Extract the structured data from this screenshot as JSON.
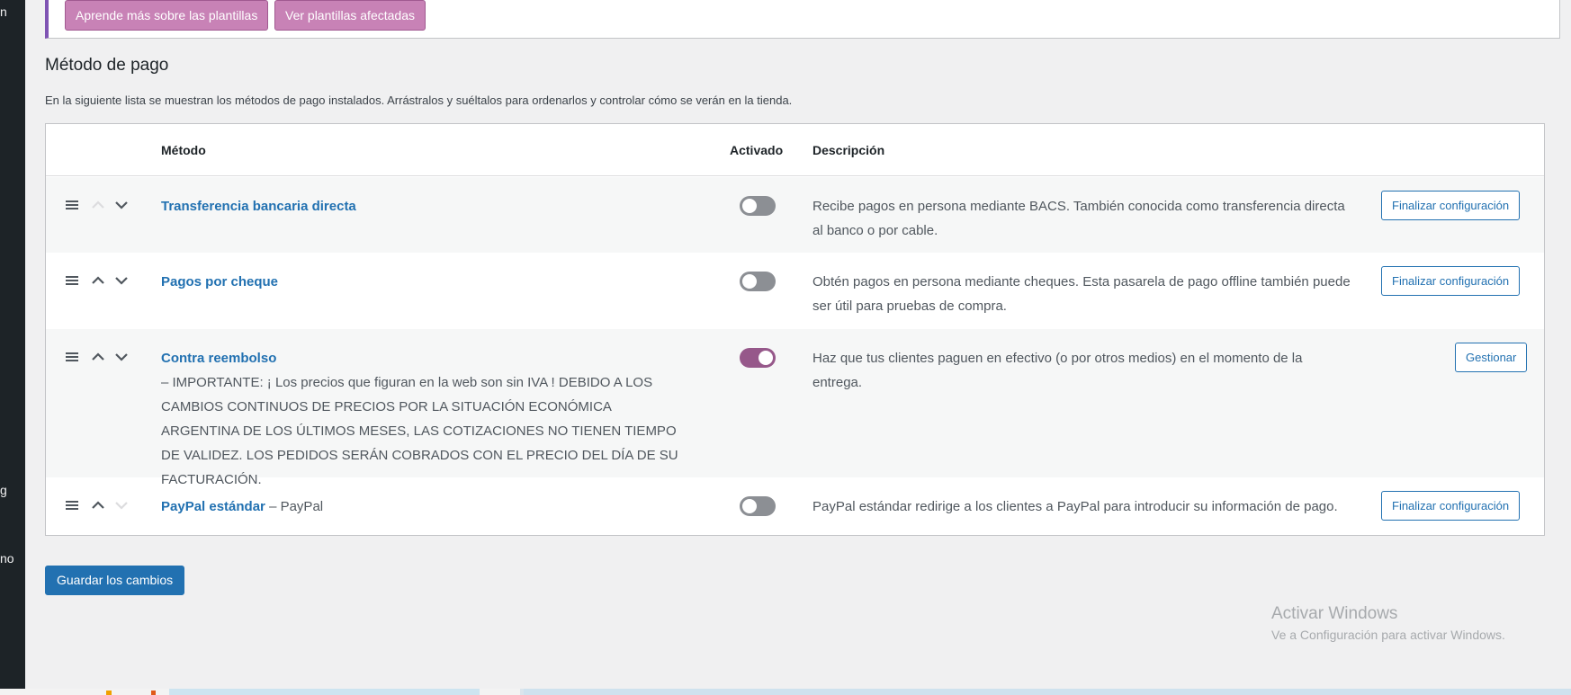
{
  "sidebar": {
    "fragments": [
      "n",
      "g",
      "no"
    ]
  },
  "notice": {
    "buttons": [
      "Aprende más sobre las plantillas",
      "Ver plantillas afectadas"
    ]
  },
  "section": {
    "title": "Método de pago",
    "description": "En la siguiente lista se muestran los métodos de pago instalados. Arrástralos y suéltalos para ordenarlos y controlar cómo se verán en la tienda."
  },
  "table": {
    "headers": {
      "method": "Método",
      "enabled": "Activado",
      "description": "Descripción"
    },
    "rows": [
      {
        "name": "Transferencia bancaria directa",
        "suffix": "",
        "note": "",
        "enabled": false,
        "up_enabled": false,
        "down_enabled": true,
        "description": "Recibe pagos en persona mediante BACS. También conocida como transferencia directa al banco o por cable.",
        "action": "Finalizar configuración"
      },
      {
        "name": "Pagos por cheque",
        "suffix": "",
        "note": "",
        "enabled": false,
        "up_enabled": true,
        "down_enabled": true,
        "description": "Obtén pagos en persona mediante cheques. Esta pasarela de pago offline también puede ser útil para pruebas de compra.",
        "action": "Finalizar configuración"
      },
      {
        "name": "Contra reembolso",
        "suffix": "",
        "note": "– IMPORTANTE: ¡ Los precios que figuran en la web son sin IVA ! DEBIDO A LOS CAMBIOS CONTINUOS DE PRECIOS POR LA SITUACIÓN ECONÓMICA ARGENTINA DE LOS ÚLTIMOS MESES, LAS COTIZACIONES NO TIENEN TIEMPO DE VALIDEZ. LOS PEDIDOS SERÁN COBRADOS CON EL PRECIO DEL DÍA DE SU FACTURACIÓN.",
        "enabled": true,
        "up_enabled": true,
        "down_enabled": true,
        "description": "Haz que tus clientes paguen en efectivo (o por otros medios) en el momento de la entrega.",
        "action": "Gestionar"
      },
      {
        "name": "PayPal estándar",
        "suffix": "– PayPal",
        "note": "",
        "enabled": false,
        "up_enabled": true,
        "down_enabled": false,
        "description": "PayPal estándar redirige a los clientes a PayPal para introducir su información de pago.",
        "action": "Finalizar configuración"
      }
    ]
  },
  "save_button": "Guardar los cambios",
  "watermark": {
    "title": "Activar Windows",
    "subtitle": "Ve a Configuración para activar Windows."
  },
  "colors": {
    "link": "#2271b1",
    "toggle_on": "#96588a",
    "toggle_off": "#8c8f94",
    "notice_button": "#c882b6",
    "sidebar": "#1d2327",
    "background": "#f0f0f1"
  }
}
